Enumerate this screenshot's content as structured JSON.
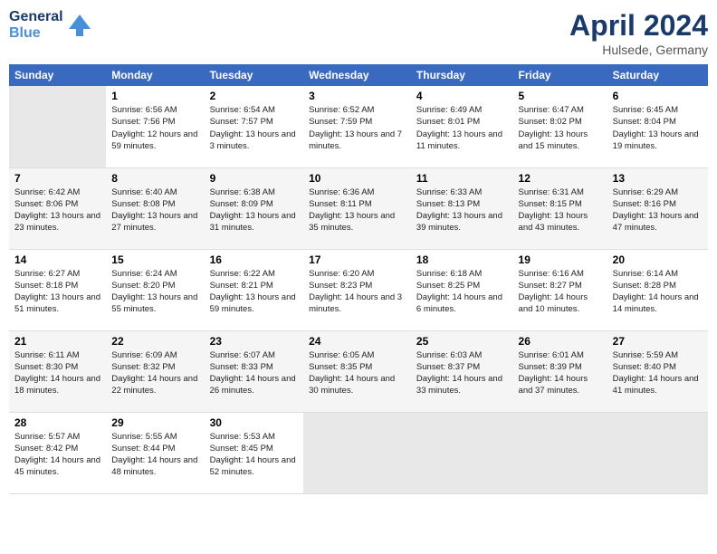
{
  "header": {
    "logo_line1": "General",
    "logo_line2": "Blue",
    "month": "April 2024",
    "location": "Hulsede, Germany"
  },
  "weekdays": [
    "Sunday",
    "Monday",
    "Tuesday",
    "Wednesday",
    "Thursday",
    "Friday",
    "Saturday"
  ],
  "weeks": [
    [
      {
        "day": "",
        "sunrise": "",
        "sunset": "",
        "daylight": "",
        "empty": true
      },
      {
        "day": "1",
        "sunrise": "6:56 AM",
        "sunset": "7:56 PM",
        "daylight": "12 hours and 59 minutes."
      },
      {
        "day": "2",
        "sunrise": "6:54 AM",
        "sunset": "7:57 PM",
        "daylight": "13 hours and 3 minutes."
      },
      {
        "day": "3",
        "sunrise": "6:52 AM",
        "sunset": "7:59 PM",
        "daylight": "13 hours and 7 minutes."
      },
      {
        "day": "4",
        "sunrise": "6:49 AM",
        "sunset": "8:01 PM",
        "daylight": "13 hours and 11 minutes."
      },
      {
        "day": "5",
        "sunrise": "6:47 AM",
        "sunset": "8:02 PM",
        "daylight": "13 hours and 15 minutes."
      },
      {
        "day": "6",
        "sunrise": "6:45 AM",
        "sunset": "8:04 PM",
        "daylight": "13 hours and 19 minutes."
      }
    ],
    [
      {
        "day": "7",
        "sunrise": "6:42 AM",
        "sunset": "8:06 PM",
        "daylight": "13 hours and 23 minutes."
      },
      {
        "day": "8",
        "sunrise": "6:40 AM",
        "sunset": "8:08 PM",
        "daylight": "13 hours and 27 minutes."
      },
      {
        "day": "9",
        "sunrise": "6:38 AM",
        "sunset": "8:09 PM",
        "daylight": "13 hours and 31 minutes."
      },
      {
        "day": "10",
        "sunrise": "6:36 AM",
        "sunset": "8:11 PM",
        "daylight": "13 hours and 35 minutes."
      },
      {
        "day": "11",
        "sunrise": "6:33 AM",
        "sunset": "8:13 PM",
        "daylight": "13 hours and 39 minutes."
      },
      {
        "day": "12",
        "sunrise": "6:31 AM",
        "sunset": "8:15 PM",
        "daylight": "13 hours and 43 minutes."
      },
      {
        "day": "13",
        "sunrise": "6:29 AM",
        "sunset": "8:16 PM",
        "daylight": "13 hours and 47 minutes."
      }
    ],
    [
      {
        "day": "14",
        "sunrise": "6:27 AM",
        "sunset": "8:18 PM",
        "daylight": "13 hours and 51 minutes."
      },
      {
        "day": "15",
        "sunrise": "6:24 AM",
        "sunset": "8:20 PM",
        "daylight": "13 hours and 55 minutes."
      },
      {
        "day": "16",
        "sunrise": "6:22 AM",
        "sunset": "8:21 PM",
        "daylight": "13 hours and 59 minutes."
      },
      {
        "day": "17",
        "sunrise": "6:20 AM",
        "sunset": "8:23 PM",
        "daylight": "14 hours and 3 minutes."
      },
      {
        "day": "18",
        "sunrise": "6:18 AM",
        "sunset": "8:25 PM",
        "daylight": "14 hours and 6 minutes."
      },
      {
        "day": "19",
        "sunrise": "6:16 AM",
        "sunset": "8:27 PM",
        "daylight": "14 hours and 10 minutes."
      },
      {
        "day": "20",
        "sunrise": "6:14 AM",
        "sunset": "8:28 PM",
        "daylight": "14 hours and 14 minutes."
      }
    ],
    [
      {
        "day": "21",
        "sunrise": "6:11 AM",
        "sunset": "8:30 PM",
        "daylight": "14 hours and 18 minutes."
      },
      {
        "day": "22",
        "sunrise": "6:09 AM",
        "sunset": "8:32 PM",
        "daylight": "14 hours and 22 minutes."
      },
      {
        "day": "23",
        "sunrise": "6:07 AM",
        "sunset": "8:33 PM",
        "daylight": "14 hours and 26 minutes."
      },
      {
        "day": "24",
        "sunrise": "6:05 AM",
        "sunset": "8:35 PM",
        "daylight": "14 hours and 30 minutes."
      },
      {
        "day": "25",
        "sunrise": "6:03 AM",
        "sunset": "8:37 PM",
        "daylight": "14 hours and 33 minutes."
      },
      {
        "day": "26",
        "sunrise": "6:01 AM",
        "sunset": "8:39 PM",
        "daylight": "14 hours and 37 minutes."
      },
      {
        "day": "27",
        "sunrise": "5:59 AM",
        "sunset": "8:40 PM",
        "daylight": "14 hours and 41 minutes."
      }
    ],
    [
      {
        "day": "28",
        "sunrise": "5:57 AM",
        "sunset": "8:42 PM",
        "daylight": "14 hours and 45 minutes."
      },
      {
        "day": "29",
        "sunrise": "5:55 AM",
        "sunset": "8:44 PM",
        "daylight": "14 hours and 48 minutes."
      },
      {
        "day": "30",
        "sunrise": "5:53 AM",
        "sunset": "8:45 PM",
        "daylight": "14 hours and 52 minutes."
      },
      {
        "day": "",
        "sunrise": "",
        "sunset": "",
        "daylight": "",
        "empty": true
      },
      {
        "day": "",
        "sunrise": "",
        "sunset": "",
        "daylight": "",
        "empty": true
      },
      {
        "day": "",
        "sunrise": "",
        "sunset": "",
        "daylight": "",
        "empty": true
      },
      {
        "day": "",
        "sunrise": "",
        "sunset": "",
        "daylight": "",
        "empty": true
      }
    ]
  ],
  "labels": {
    "sunrise_prefix": "Sunrise: ",
    "sunset_prefix": "Sunset: ",
    "daylight_prefix": "Daylight: "
  }
}
